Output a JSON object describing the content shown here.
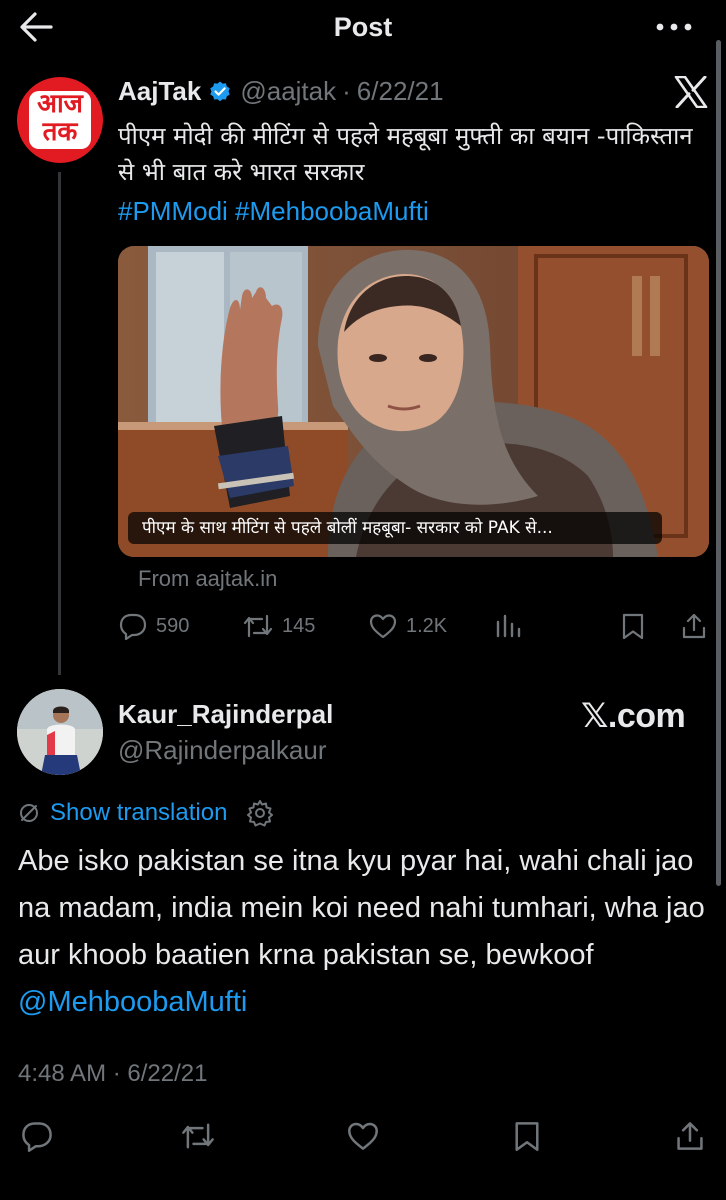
{
  "header": {
    "title": "Post",
    "back_icon": "arrow-left-icon",
    "more_icon": "more-horizontal-icon"
  },
  "quoted": {
    "avatar_text": {
      "line1": "आज",
      "line2": "तक"
    },
    "name": "AajTak",
    "handle": "@aajtak",
    "separator": "·",
    "date": "6/22/21",
    "text": "पीएम मोदी की मीटिंग से पहले महबूबा मुफ्ती का बयान -पाकिस्तान से भी बात करे भारत सरकार",
    "hashtags": "#PMModi #MehboobaMufti",
    "media_caption": "पीएम के साथ मीटिंग से पहले बोलीं महबूबा- सरकार को PAK से...",
    "source": "From aajtak.in",
    "stats": {
      "replies": "590",
      "reposts": "145",
      "likes": "1.2K"
    }
  },
  "reply": {
    "name": "Kaur_Rajinderpal",
    "handle": "@Rajinderpalkaur",
    "brand": "𝕏.com",
    "show_translation": "Show translation",
    "text_plain": "Abe isko pakistan se itna kyu pyar hai, wahi chali jao na madam, india mein koi need nahi tumhari, wha jao aur khoob baatien krna pakistan se, bewkoof ",
    "mention": "@MehboobaMufti",
    "timestamp": "4:48 AM · 6/22/21"
  },
  "colors": {
    "background": "#000000",
    "text": "#e7e9ea",
    "muted": "#71767b",
    "link": "#1d9bf0",
    "brand_red": "#e21b22"
  }
}
